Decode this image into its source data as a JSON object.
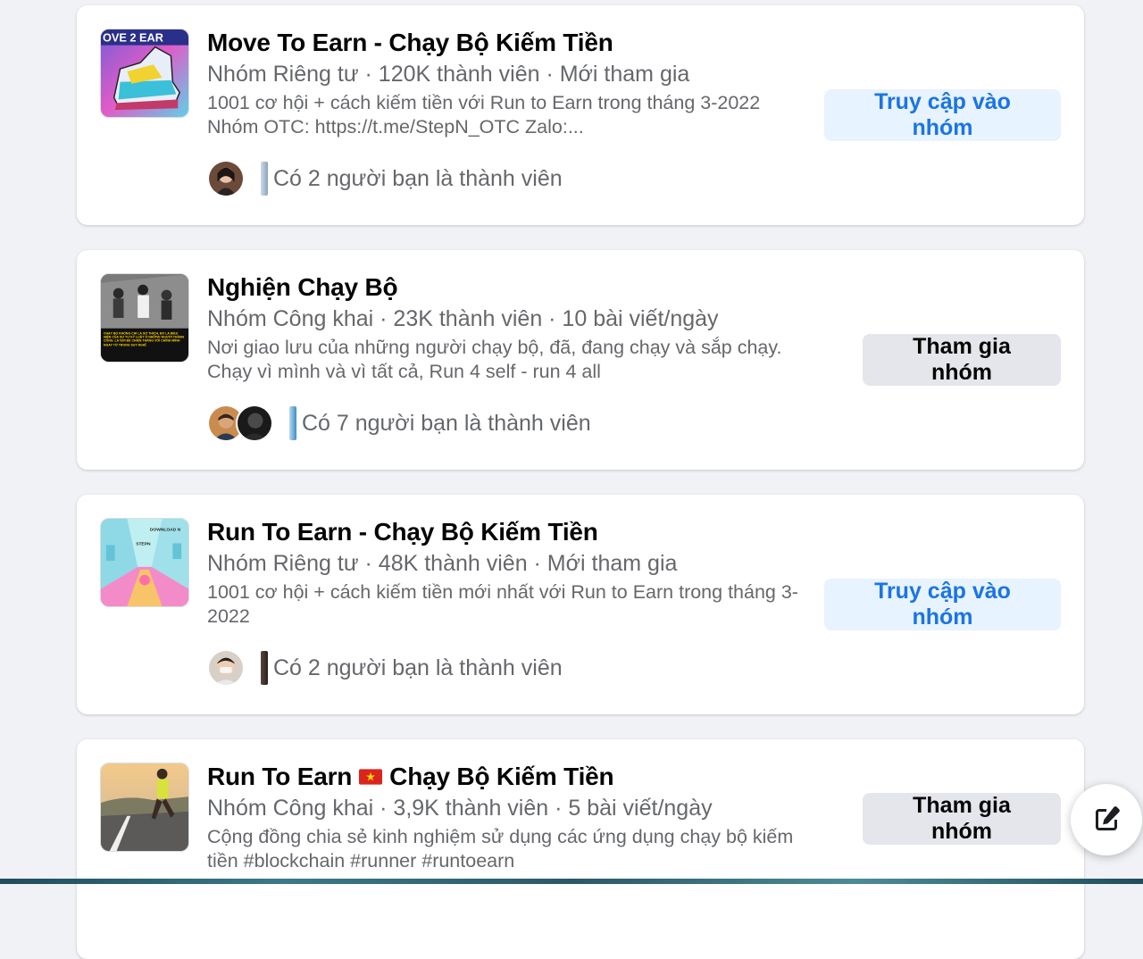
{
  "groups": [
    {
      "name": "Move To Earn - Chạy Bộ Kiếm Tiền",
      "meta": "Nhóm Riêng tư · 120K thành viên · Mới tham gia",
      "description": "1001 cơ hội + cách kiếm tiền với Run to Earn trong tháng 3-2022 Nhóm OTC: https://t.me/StepN_OTC Zalo:...",
      "thumbnail_text": "OVE 2 EAR",
      "friends_text": "Có 2 người bạn là thành viên",
      "button_label": "Truy cập vào nhóm"
    },
    {
      "name": "Nghiện Chạy Bộ",
      "meta": "Nhóm Công khai · 23K thành viên · 10 bài viết/ngày",
      "description": "Nơi giao lưu của những người chạy bộ, đã, đang chạy và sắp chạy. Chạy vì mình và vì tất cả, Run 4 self - run 4 all",
      "thumbnail_text": "CHẠY BỘ KHÔNG CHỈ LÀ SỞ THÍCH, ĐÓ LÀ BIỂU HIỆN CỦA SỰ TỰ KỶ LUẬT Ở NHỮNG NGƯỜI THÀNH CÔNG. LÀ NƠI ĐỂ CHIẾN THẮNG VỚI CHÍNH MÌNH NGAY TỪ TRONG SUY NGHĨ.",
      "friends_text": "Có 7 người bạn là thành viên",
      "button_label": "Tham gia nhóm"
    },
    {
      "name": "Run To Earn - Chạy Bộ Kiếm Tiền",
      "meta": "Nhóm Riêng tư · 48K thành viên · Mới tham gia",
      "description": "1001 cơ hội + cách kiếm tiền mới nhất với Run to Earn trong tháng 3-2022",
      "thumbnail_text": "DOWNLOAD N",
      "thumbnail_text_2": "STEPN",
      "friends_text": "Có 2 người bạn là thành viên",
      "button_label": "Truy cập vào nhóm"
    },
    {
      "name_part1": "Run To Earn",
      "name_part2": "Chạy Bộ Kiếm Tiền",
      "flag_icon": "vietnam-flag-icon",
      "meta": "Nhóm Công khai · 3,9K thành viên · 5 bài viết/ngày",
      "description": "Cộng đồng chia sẻ kinh nghiệm sử dụng các ứng dụng chạy bộ kiếm tiền #blockchain #runner #runtoearn",
      "button_label": "Tham gia nhóm"
    }
  ],
  "colors": {
    "page_bg": "#f0f2f5",
    "card_bg": "#ffffff",
    "visit_bg": "#e7f3ff",
    "visit_text": "#1b74e4",
    "join_bg": "#e4e6eb",
    "secondary_text": "#65676b"
  },
  "floating_action": {
    "icon": "edit-compose-icon"
  }
}
